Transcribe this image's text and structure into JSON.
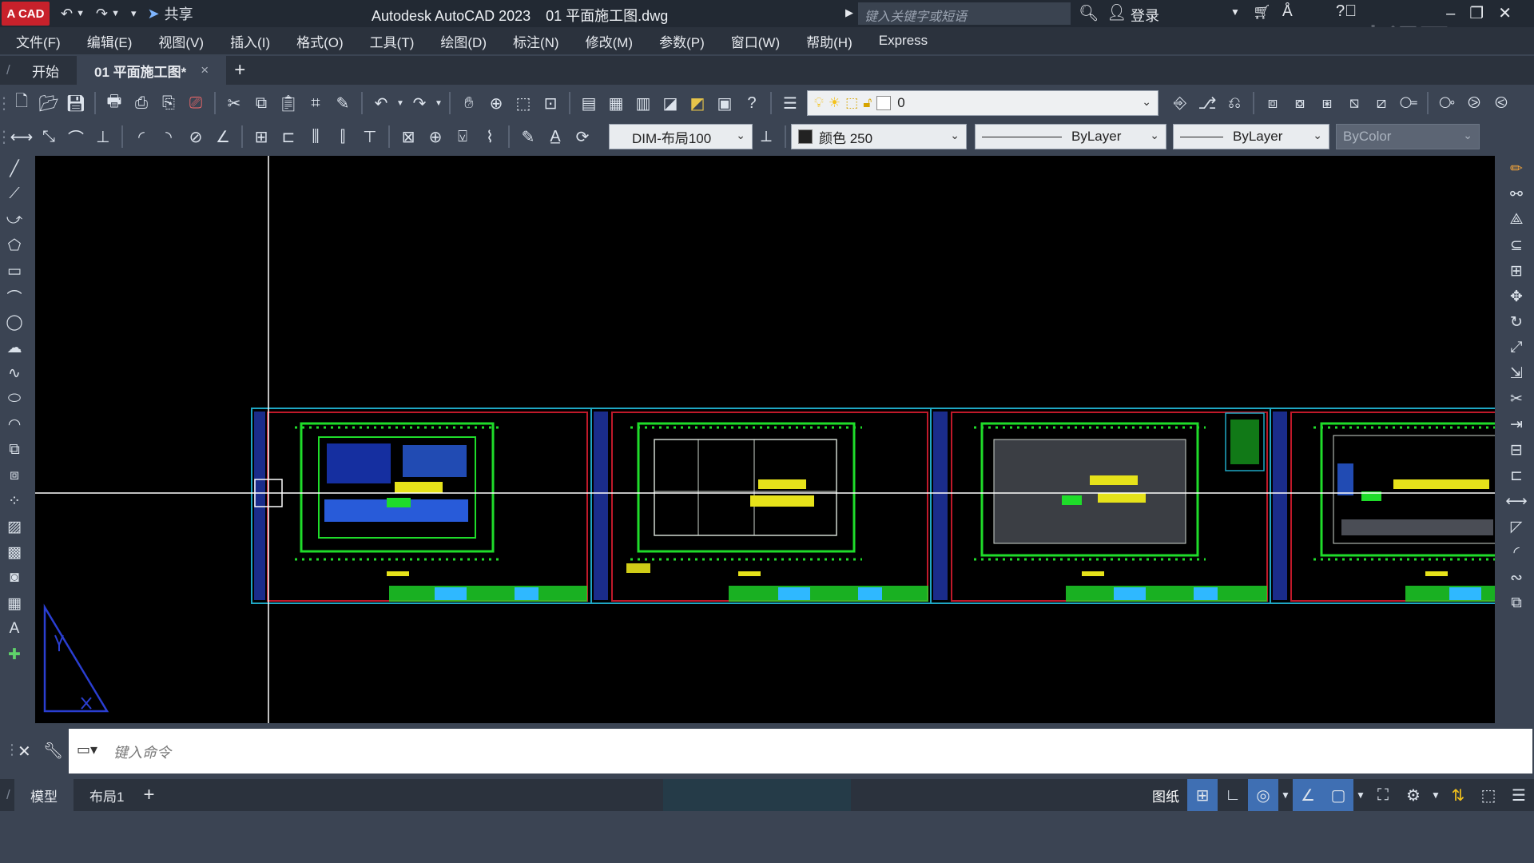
{
  "app": {
    "badge": "A CAD",
    "share": "共享",
    "title": "Autodesk AutoCAD 2023",
    "file_name": "01 平面施工图.dwg",
    "search_placeholder": "键入关键字或短语",
    "login": "登录",
    "watermark": "虎课网"
  },
  "menubar": [
    "文件(F)",
    "编辑(E)",
    "视图(V)",
    "插入(I)",
    "格式(O)",
    "工具(T)",
    "绘图(D)",
    "标注(N)",
    "修改(M)",
    "参数(P)",
    "窗口(W)",
    "帮助(H)",
    "Express"
  ],
  "tabs": {
    "start": "开始",
    "doc": "01 平面施工图*",
    "close": "×",
    "new": "+"
  },
  "toolbar1": {
    "layer_value": "0"
  },
  "toolbar2": {
    "dimstyle": "DIM-布局100",
    "color": "颜色 250",
    "linetype": "ByLayer",
    "lineweight": "ByLayer",
    "plotstyle": "ByColor"
  },
  "command": {
    "placeholder": "键入命令"
  },
  "status": {
    "model_tab": "模型",
    "layout_tab": "布局1",
    "add": "+",
    "paper": "图纸"
  },
  "colors": {
    "accent": "#c8212b",
    "canvas_bg": "#000000",
    "frame_cyan": "#1fa7c4",
    "frame_red": "#c0192a",
    "plan_green": "#1fdc2a",
    "plan_blue": "#2f6bff",
    "plan_yellow": "#e6e21a"
  },
  "icons": {
    "undo": "undo-icon",
    "redo": "redo-icon",
    "search": "search-icon",
    "user": "user-icon",
    "cart": "cart-icon",
    "help": "help-icon"
  }
}
